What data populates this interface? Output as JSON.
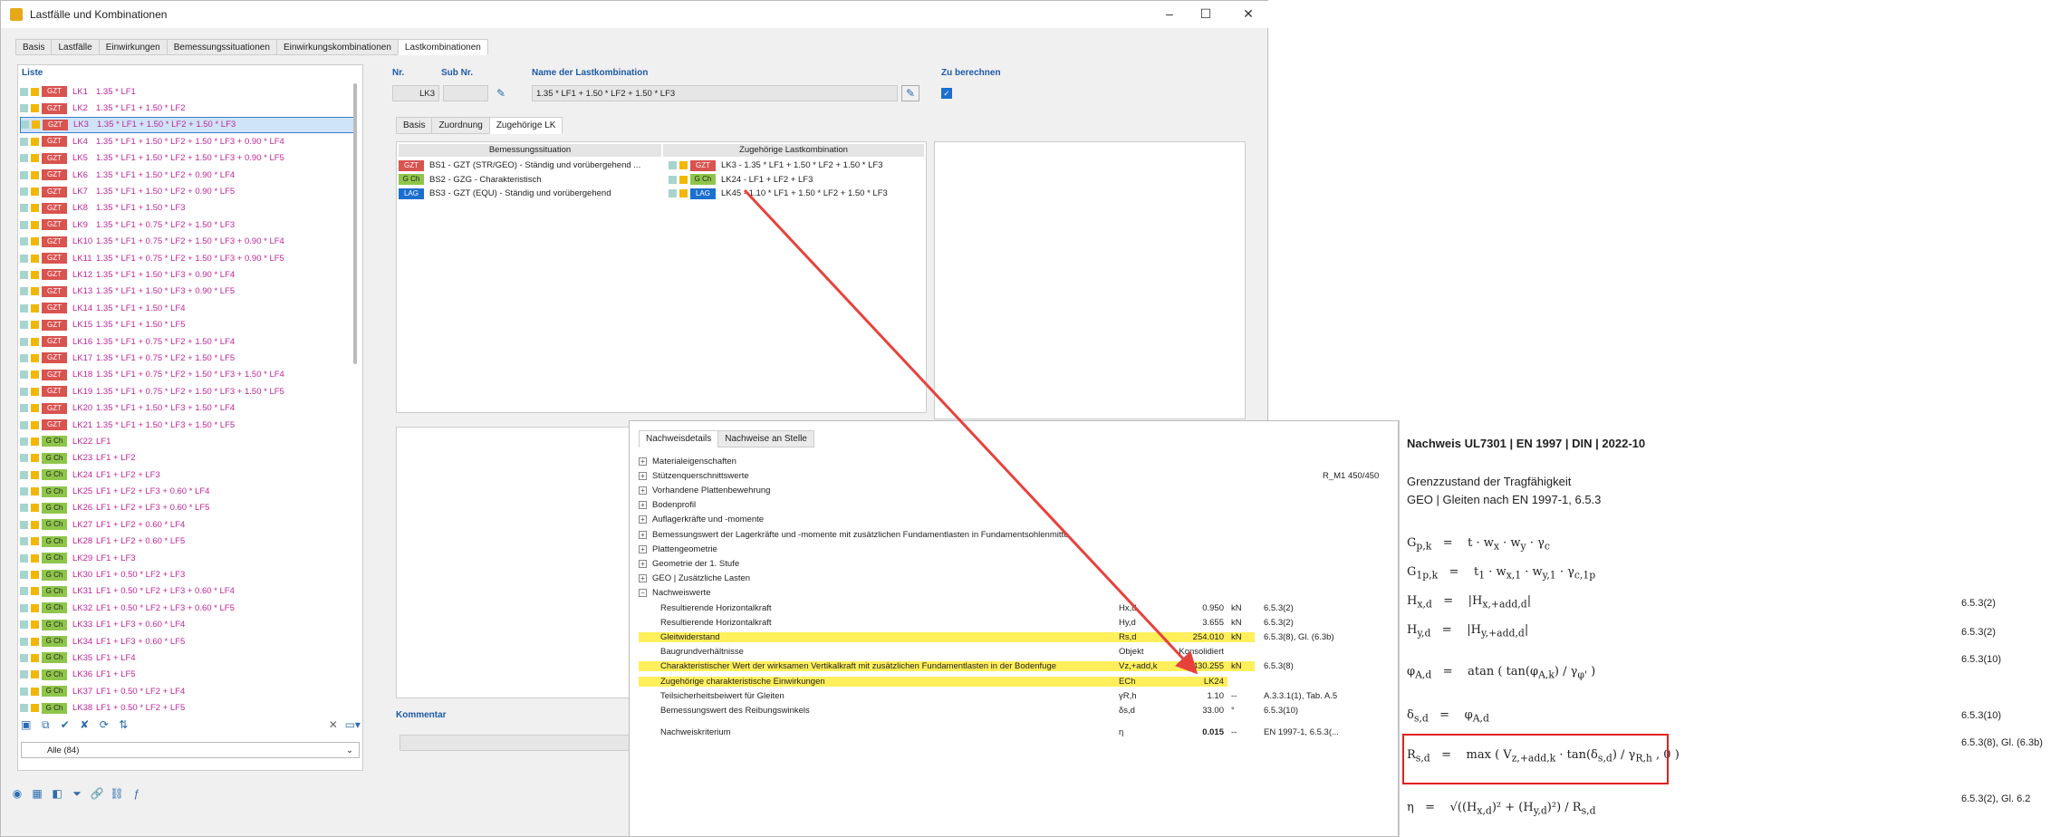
{
  "window": {
    "title": "Lastfälle und Kombinationen"
  },
  "tabs": [
    "Basis",
    "Lastfälle",
    "Einwirkungen",
    "Bemessungssituationen",
    "Einwirkungskombinationen",
    "Lastkombinationen"
  ],
  "list": {
    "header": "Liste",
    "filter": "Alle (84)",
    "items": [
      {
        "badge": "GZT",
        "name": "LK1",
        "formula": "1.35 * LF1"
      },
      {
        "badge": "GZT",
        "name": "LK2",
        "formula": "1.35 * LF1 + 1.50 * LF2"
      },
      {
        "badge": "GZT",
        "name": "LK3",
        "formula": "1.35 * LF1 + 1.50 * LF2 + 1.50 * LF3"
      },
      {
        "badge": "GZT",
        "name": "LK4",
        "formula": "1.35 * LF1 + 1.50 * LF2 + 1.50 * LF3 + 0.90 * LF4"
      },
      {
        "badge": "GZT",
        "name": "LK5",
        "formula": "1.35 * LF1 + 1.50 * LF2 + 1.50 * LF3 + 0.90 * LF5"
      },
      {
        "badge": "GZT",
        "name": "LK6",
        "formula": "1.35 * LF1 + 1.50 * LF2 + 0.90 * LF4"
      },
      {
        "badge": "GZT",
        "name": "LK7",
        "formula": "1.35 * LF1 + 1.50 * LF2 + 0.90 * LF5"
      },
      {
        "badge": "GZT",
        "name": "LK8",
        "formula": "1.35 * LF1 + 1.50 * LF3"
      },
      {
        "badge": "GZT",
        "name": "LK9",
        "formula": "1.35 * LF1 + 0.75 * LF2 + 1.50 * LF3"
      },
      {
        "badge": "GZT",
        "name": "LK10",
        "formula": "1.35 * LF1 + 0.75 * LF2 + 1.50 * LF3 + 0.90 * LF4"
      },
      {
        "badge": "GZT",
        "name": "LK11",
        "formula": "1.35 * LF1 + 0.75 * LF2 + 1.50 * LF3 + 0.90 * LF5"
      },
      {
        "badge": "GZT",
        "name": "LK12",
        "formula": "1.35 * LF1 + 1.50 * LF3 + 0.90 * LF4"
      },
      {
        "badge": "GZT",
        "name": "LK13",
        "formula": "1.35 * LF1 + 1.50 * LF3 + 0.90 * LF5"
      },
      {
        "badge": "GZT",
        "name": "LK14",
        "formula": "1.35 * LF1 + 1.50 * LF4"
      },
      {
        "badge": "GZT",
        "name": "LK15",
        "formula": "1.35 * LF1 + 1.50 * LF5"
      },
      {
        "badge": "GZT",
        "name": "LK16",
        "formula": "1.35 * LF1 + 0.75 * LF2 + 1.50 * LF4"
      },
      {
        "badge": "GZT",
        "name": "LK17",
        "formula": "1.35 * LF1 + 0.75 * LF2 + 1.50 * LF5"
      },
      {
        "badge": "GZT",
        "name": "LK18",
        "formula": "1.35 * LF1 + 0.75 * LF2 + 1.50 * LF3 + 1.50 * LF4"
      },
      {
        "badge": "GZT",
        "name": "LK19",
        "formula": "1.35 * LF1 + 0.75 * LF2 + 1.50 * LF3 + 1.50 * LF5"
      },
      {
        "badge": "GZT",
        "name": "LK20",
        "formula": "1.35 * LF1 + 1.50 * LF3 + 1.50 * LF4"
      },
      {
        "badge": "GZT",
        "name": "LK21",
        "formula": "1.35 * LF1 + 1.50 * LF3 + 1.50 * LF5"
      },
      {
        "badge": "G Ch",
        "name": "LK22",
        "formula": "LF1"
      },
      {
        "badge": "G Ch",
        "name": "LK23",
        "formula": "LF1 + LF2"
      },
      {
        "badge": "G Ch",
        "name": "LK24",
        "formula": "LF1 + LF2 + LF3"
      },
      {
        "badge": "G Ch",
        "name": "LK25",
        "formula": "LF1 + LF2 + LF3 + 0.60 * LF4"
      },
      {
        "badge": "G Ch",
        "name": "LK26",
        "formula": "LF1 + LF2 + LF3 + 0.60 * LF5"
      },
      {
        "badge": "G Ch",
        "name": "LK27",
        "formula": "LF1 + LF2 + 0.60 * LF4"
      },
      {
        "badge": "G Ch",
        "name": "LK28",
        "formula": "LF1 + LF2 + 0.60 * LF5"
      },
      {
        "badge": "G Ch",
        "name": "LK29",
        "formula": "LF1 + LF3"
      },
      {
        "badge": "G Ch",
        "name": "LK30",
        "formula": "LF1 + 0.50 * LF2 + LF3"
      },
      {
        "badge": "G Ch",
        "name": "LK31",
        "formula": "LF1 + 0.50 * LF2 + LF3 + 0.60 * LF4"
      },
      {
        "badge": "G Ch",
        "name": "LK32",
        "formula": "LF1 + 0.50 * LF2 + LF3 + 0.60 * LF5"
      },
      {
        "badge": "G Ch",
        "name": "LK33",
        "formula": "LF1 + LF3 + 0.60 * LF4"
      },
      {
        "badge": "G Ch",
        "name": "LK34",
        "formula": "LF1 + LF3 + 0.60 * LF5"
      },
      {
        "badge": "G Ch",
        "name": "LK35",
        "formula": "LF1 + LF4"
      },
      {
        "badge": "G Ch",
        "name": "LK36",
        "formula": "LF1 + LF5"
      },
      {
        "badge": "G Ch",
        "name": "LK37",
        "formula": "LF1 + 0.50 * LF2 + LF4"
      },
      {
        "badge": "G Ch",
        "name": "LK38",
        "formula": "LF1 + 0.50 * LF2 + LF5"
      }
    ]
  },
  "form": {
    "nr_label": "Nr.",
    "sub_label": "Sub Nr.",
    "name_label": "Name der Lastkombination",
    "calc_label": "Zu berechnen",
    "nr_value": "LK3",
    "name_value": "1.35 * LF1 + 1.50 * LF2 + 1.50 * LF3"
  },
  "subtabs": [
    "Basis",
    "Zuordnung",
    "Zugehörige LK"
  ],
  "sittable": {
    "col1": "Bemessungssituation",
    "col2": "Zugehörige Lastkombination",
    "rows": [
      {
        "b1": "GZT",
        "sit": "BS1 - GZT (STR/GEO) - Ständig und vorübergehend ...",
        "b2": "GZT",
        "lk": "LK3 - 1.35 * LF1 + 1.50 * LF2 + 1.50 * LF3"
      },
      {
        "b1": "G Ch",
        "sit": "BS2 - GZG - Charakteristisch",
        "b2": "G Ch",
        "lk": "LK24 - LF1 + LF2 + LF3"
      },
      {
        "b1": "LAG",
        "sit": "BS3 - GZT (EQU) - Ständig und vorübergehend",
        "b2": "LAG",
        "lk": "LK45 - 1.10 * LF1 + 1.50 * LF2 + 1.50 * LF3"
      }
    ]
  },
  "kommentar": "Kommentar",
  "nw": {
    "tabs": [
      "Nachweisdetails",
      "Nachweise an Stelle"
    ],
    "sections": [
      {
        "t": "Materialeigenschaften",
        "r": ""
      },
      {
        "t": "Stützenquerschnittswerte",
        "r": "R_M1 450/450"
      },
      {
        "t": "Vorhandene Plattenbewehrung",
        "r": ""
      },
      {
        "t": "Bodenprofil",
        "r": ""
      },
      {
        "t": "Auflagerkräfte und -momente",
        "r": ""
      },
      {
        "t": "Bemessungswert der Lagerkräfte und -momente mit zusätzlichen Fundamentlasten in Fundamentsohlenmitte",
        "r": ""
      },
      {
        "t": "Plattengeometrie",
        "r": ""
      },
      {
        "t": "Geometrie der 1. Stufe",
        "r": ""
      },
      {
        "t": "GEO | Zusätzliche Lasten",
        "r": ""
      },
      {
        "t": "Nachweiswerte",
        "r": ""
      }
    ],
    "values": [
      {
        "d": "Resultierende Horizontalkraft",
        "s": "Hx,d",
        "v": "0.950",
        "u": "kN",
        "ref": "6.5.3(2)",
        "hl": false
      },
      {
        "d": "Resultierende Horizontalkraft",
        "s": "Hy,d",
        "v": "3.655",
        "u": "kN",
        "ref": "6.5.3(2)",
        "hl": false
      },
      {
        "d": "Gleitwiderstand",
        "s": "Rs,d",
        "v": "254.010",
        "u": "kN",
        "ref": "6.5.3(8), Gl. (6.3b)",
        "hl": true
      },
      {
        "d": "Baugrundverhältnisse",
        "s": "Objekt",
        "v": "Konsolidiert",
        "u": "",
        "ref": "",
        "hl": false
      },
      {
        "d": "Charakteristischer Wert der wirksamen Vertikalkraft mit zusätzlichen Fundamentlasten in der Bodenfuge",
        "s": "Vz,+add,k",
        "v": "430.255",
        "u": "kN",
        "ref": "6.5.3(8)",
        "hl": true
      },
      {
        "d": "Zugehörige charakteristische Einwirkungen",
        "s": "ECh",
        "v": "LK24",
        "u": "",
        "ref": "",
        "hl": true
      },
      {
        "d": "Teilsicherheitsbeiwert für Gleiten",
        "s": "γR,h",
        "v": "1.10",
        "u": "--",
        "ref": "A.3.3.1(1), Tab. A.5",
        "hl": false
      },
      {
        "d": "Bemessungswert des Reibungswinkels",
        "s": "δs,d",
        "v": "33.00",
        "u": "°",
        "ref": "6.5.3(10)",
        "hl": false
      },
      {
        "d": "Nachweiskriterium",
        "s": "η",
        "v": "0.015",
        "u": "--",
        "ref": "EN 1997-1, 6.5.3(...",
        "hl": false
      }
    ]
  },
  "report": {
    "title": "Nachweis UL7301 | EN 1997 | DIN | 2022-10",
    "sub1": "Grenzzustand der Tragfähigkeit",
    "sub2": "GEO | Gleiten nach EN 1997-1, 6.5.3",
    "refs": [
      "6.5.3(2)",
      "6.5.3(2)",
      "6.5.3(10)",
      "6.5.3(10)",
      "6.5.3(8), Gl. (6.3b)",
      "6.5.3(2), Gl. 6.2"
    ]
  },
  "colors": {
    "gzt": "#d9534f",
    "gch": "#8fc54a",
    "lag": "#1a6fd0",
    "formula": "#c1259a",
    "accent": "#1e5aa8",
    "highlight": "#ffef5b",
    "arrow": "#e8413c"
  }
}
